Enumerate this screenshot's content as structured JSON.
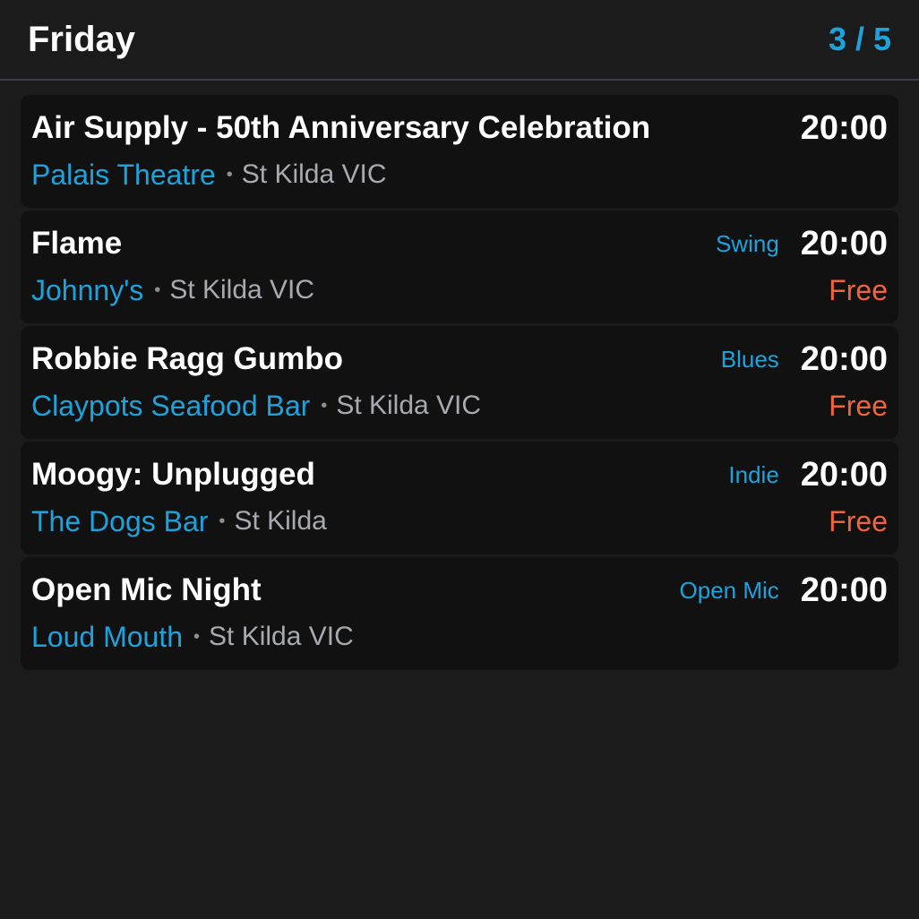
{
  "header": {
    "day": "Friday",
    "pager": "3 / 5"
  },
  "colors": {
    "accent": "#1ea2dc",
    "price": "#f0643c",
    "background": "#1b1b1c",
    "card": "#111112"
  },
  "events": [
    {
      "title": "Air Supply - 50th Anniversary Celebration",
      "genre": "",
      "time": "20:00",
      "venue": "Palais Theatre",
      "separator": "•",
      "location": "St Kilda VIC",
      "price": ""
    },
    {
      "title": "Flame",
      "genre": "Swing",
      "time": "20:00",
      "venue": "Johnny's",
      "separator": "•",
      "location": "St Kilda VIC",
      "price": "Free"
    },
    {
      "title": "Robbie Ragg Gumbo",
      "genre": "Blues",
      "time": "20:00",
      "venue": "Claypots Seafood Bar",
      "separator": "•",
      "location": "St Kilda VIC",
      "price": "Free"
    },
    {
      "title": "Moogy: Unplugged",
      "genre": "Indie",
      "time": "20:00",
      "venue": "The Dogs Bar",
      "separator": "•",
      "location": "St Kilda",
      "price": "Free"
    },
    {
      "title": "Open Mic Night",
      "genre": "Open Mic",
      "time": "20:00",
      "venue": "Loud Mouth",
      "separator": "•",
      "location": "St Kilda VIC",
      "price": ""
    }
  ]
}
